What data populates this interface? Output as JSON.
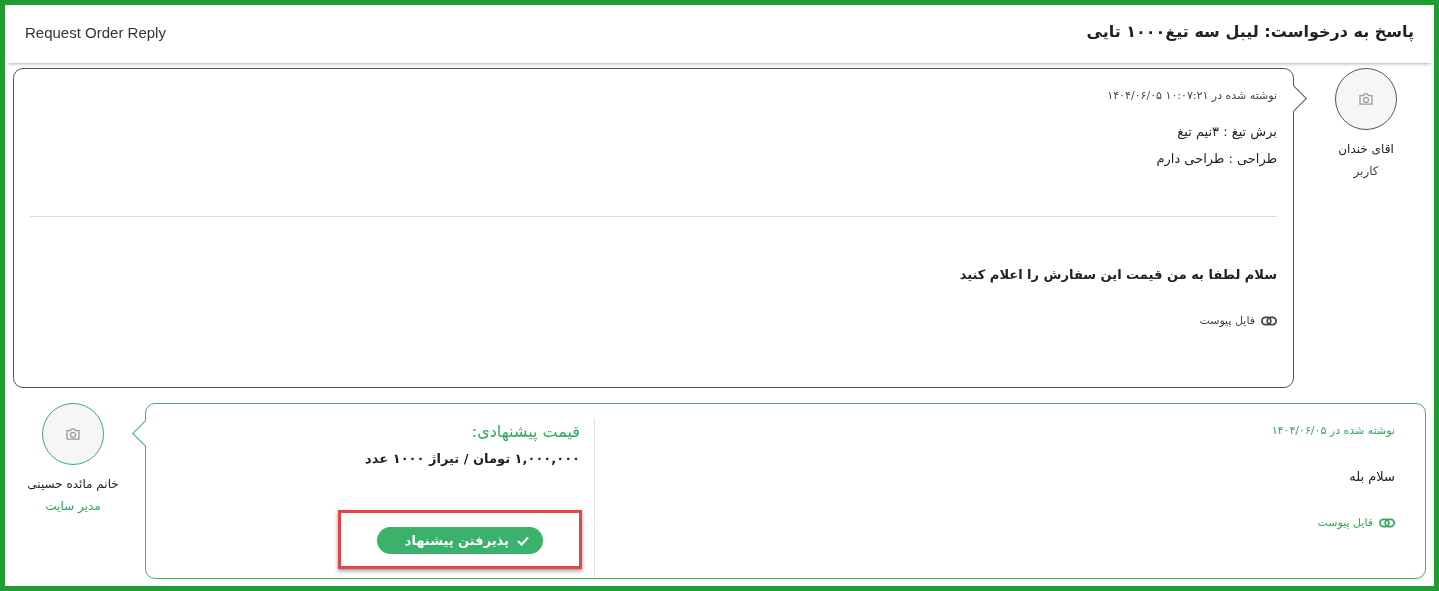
{
  "header": {
    "label": "Request Order Reply",
    "title": "پاسخ به درخواست: لیبل سه تیغ۱۰۰۰ تایی"
  },
  "messages": [
    {
      "kind": "user",
      "author": "اقای خندان",
      "role": "کاربر",
      "timestamp": "نوشته شده در ۱۰:۰۷:۲۱ ۱۴۰۴/۰۶/۰۵",
      "lines": [
        "برش تیغ : ۳نیم تیغ",
        "طراحی : طراحی دارم"
      ],
      "body": "سلام لطفا به من قیمت این سفارش را اعلام کنید",
      "attachment": "فایل پیوست"
    },
    {
      "kind": "admin",
      "author": "خانم مائده حسینی",
      "role": "مدیر سایت",
      "timestamp": "نوشته شده در ۱۴۰۴/۰۶/۰۵",
      "body": "سلام بله",
      "attachment": "فایل پیوست",
      "offer": {
        "title": "قیمت پیشنهادی:",
        "price": "۱,۰۰۰,۰۰۰ تومان / تیراژ ۱۰۰۰ عدد",
        "button": "پذیرفتن پیشنهاد",
        "highlighted": true
      }
    }
  ]
}
